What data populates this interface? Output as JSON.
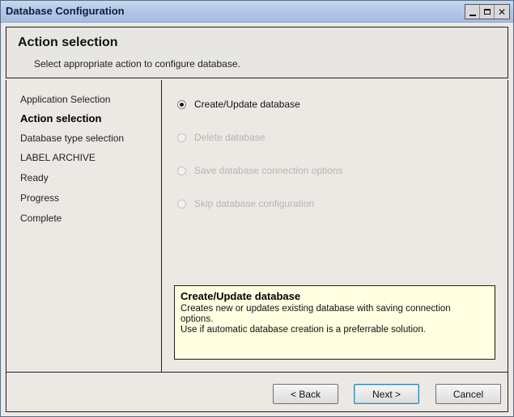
{
  "window": {
    "title": "Database Configuration",
    "controls": [
      "minimize",
      "maximize",
      "close"
    ]
  },
  "header": {
    "title": "Action selection",
    "subtitle": "Select appropriate action to configure database."
  },
  "sidebar": {
    "items": [
      {
        "label": "Application Selection",
        "active": false
      },
      {
        "label": "Action selection",
        "active": true
      },
      {
        "label": "Database type selection",
        "active": false
      },
      {
        "label": "LABEL ARCHIVE",
        "active": false
      },
      {
        "label": "Ready",
        "active": false
      },
      {
        "label": "Progress",
        "active": false
      },
      {
        "label": "Complete",
        "active": false
      }
    ]
  },
  "actions": {
    "options": [
      {
        "label": "Create/Update database",
        "selected": true,
        "enabled": true
      },
      {
        "label": "Delete database",
        "selected": false,
        "enabled": false
      },
      {
        "label": "Save database connection options",
        "selected": false,
        "enabled": false
      },
      {
        "label": "Skip database configuration",
        "selected": false,
        "enabled": false
      }
    ]
  },
  "info": {
    "title": "Create/Update database",
    "line1": "Creates new or updates existing database with saving connection",
    "line2": "options.",
    "line3": "Use if automatic database creation is a preferrable solution."
  },
  "buttons": {
    "back": "< Back",
    "next": "Next >",
    "cancel": "Cancel"
  },
  "colors": {
    "titlebar": "#b4c8e6",
    "window_bg": "#ece9e4",
    "info_bg": "#ffffe1",
    "border": "#1f1f1f"
  }
}
